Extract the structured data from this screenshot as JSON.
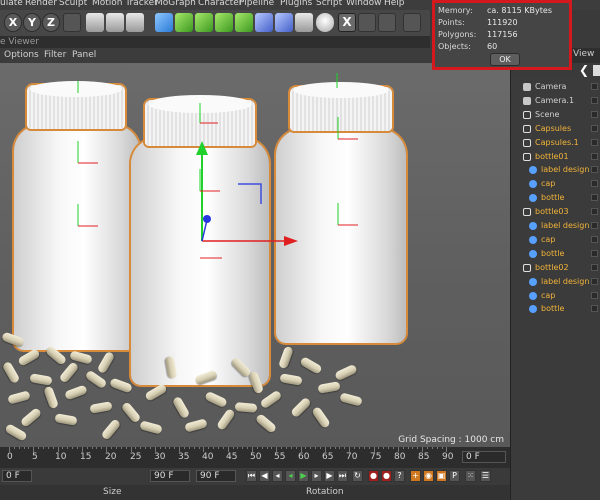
{
  "menu": [
    "ulate",
    "Render",
    "Sculpt",
    "Motion Tracker",
    "MoGraph",
    "Character",
    "Pipeline",
    "Plugins",
    "Script",
    "Window",
    "Help"
  ],
  "toolbar": {
    "x_label": "X",
    "y_label": "Y",
    "z_label": "Z",
    "close_label": "X"
  },
  "viewer": {
    "tab_label": "e Viewer",
    "menu": [
      "Options",
      "Filter",
      "Panel"
    ],
    "grid_spacing": "Grid Spacing : 1000 cm"
  },
  "info_dialog": {
    "memory_label": "Memory:",
    "memory_value": "ca. 8115 KBytes",
    "points_label": "Points:",
    "points_value": "111920",
    "polygons_label": "Polygons:",
    "polygons_value": "117156",
    "objects_label": "Objects:",
    "objects_value": "60",
    "ok_label": "OK"
  },
  "object_manager": {
    "view_label": "View",
    "items": [
      {
        "label": "Camera",
        "icon": "camera-icon",
        "color": "#d0d0d0",
        "indent": 0
      },
      {
        "label": "Camera.1",
        "icon": "camera-icon",
        "color": "#d0d0d0",
        "indent": 0
      },
      {
        "label": "Scene",
        "icon": "null-icon",
        "color": "#d0d0d0",
        "indent": 0
      },
      {
        "label": "Capsules",
        "icon": "null-icon",
        "color": "#f2b43a",
        "indent": 0
      },
      {
        "label": "Capsules.1",
        "icon": "null-icon",
        "color": "#f2b43a",
        "indent": 0
      },
      {
        "label": "bottle01",
        "icon": "null-icon",
        "color": "#f2b43a",
        "indent": 0
      },
      {
        "label": "label design",
        "icon": "object-icon",
        "color": "#f2b43a",
        "indent": 1
      },
      {
        "label": "cap",
        "icon": "object-icon",
        "color": "#f2b43a",
        "indent": 1
      },
      {
        "label": "bottle",
        "icon": "object-icon",
        "color": "#f2b43a",
        "indent": 1
      },
      {
        "label": "bottle03",
        "icon": "null-icon",
        "color": "#f2b43a",
        "indent": 0
      },
      {
        "label": "label design",
        "icon": "object-icon",
        "color": "#f2b43a",
        "indent": 1
      },
      {
        "label": "cap",
        "icon": "object-icon",
        "color": "#f2b43a",
        "indent": 1
      },
      {
        "label": "bottle",
        "icon": "object-icon",
        "color": "#f2b43a",
        "indent": 1
      },
      {
        "label": "bottle02",
        "icon": "null-icon",
        "color": "#f2b43a",
        "indent": 0
      },
      {
        "label": "label design",
        "icon": "object-icon",
        "color": "#f2b43a",
        "indent": 1
      },
      {
        "label": "cap",
        "icon": "object-icon",
        "color": "#f2b43a",
        "indent": 1
      },
      {
        "label": "bottle",
        "icon": "object-icon",
        "color": "#f2b43a",
        "indent": 1
      }
    ]
  },
  "timeline": {
    "ticks": [
      "0",
      "5",
      "10",
      "15",
      "20",
      "25",
      "30",
      "35",
      "40",
      "45",
      "50",
      "55",
      "60",
      "65",
      "70",
      "75",
      "80",
      "85",
      "90"
    ],
    "current_frame": "0 F"
  },
  "transport": {
    "start_field": "0 F",
    "end_field": "90 F",
    "end_field2": "90 F",
    "current_field": "0 F"
  },
  "bottom": {
    "size_label": "Size",
    "rotation_label": "Rotation"
  },
  "colors": {
    "selection_outline": "#d68a3a",
    "highlight": "#d3181e",
    "object_label": "#f2b43a"
  }
}
